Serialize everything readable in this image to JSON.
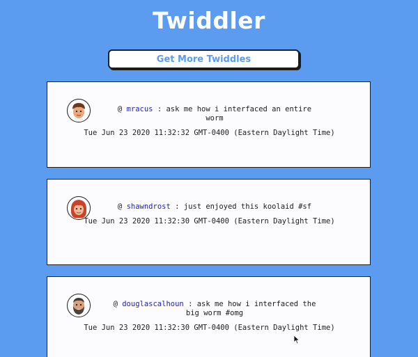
{
  "app": {
    "logo": "Twiddler"
  },
  "toolbar": {
    "more_label": "Get More Twiddles"
  },
  "feed": [
    {
      "handle": "mracus",
      "message": "ask me how i interfaced an entire worm",
      "timestamp": "Tue Jun 23 2020 11:32:32 GMT-0400 (Eastern Daylight Time)",
      "avatar": "male-memoji-avatar"
    },
    {
      "handle": "shawndrost",
      "message": "just enjoyed this koolaid #sf",
      "timestamp": "Tue Jun 23 2020 11:32:30 GMT-0400 (Eastern Daylight Time)",
      "avatar": "red-hair-memoji-avatar"
    },
    {
      "handle": "douglascalhoun",
      "message": "ask me how i interfaced the big worm #omg",
      "timestamp": "Tue Jun 23 2020 11:32:30 GMT-0400 (Eastern Daylight Time)",
      "avatar": "bearded-memoji-avatar"
    }
  ],
  "colors": {
    "background": "#5b9bf0",
    "accent": "#5b9bf0",
    "handle": "#1f1faa",
    "card": "#fcfcfe"
  }
}
